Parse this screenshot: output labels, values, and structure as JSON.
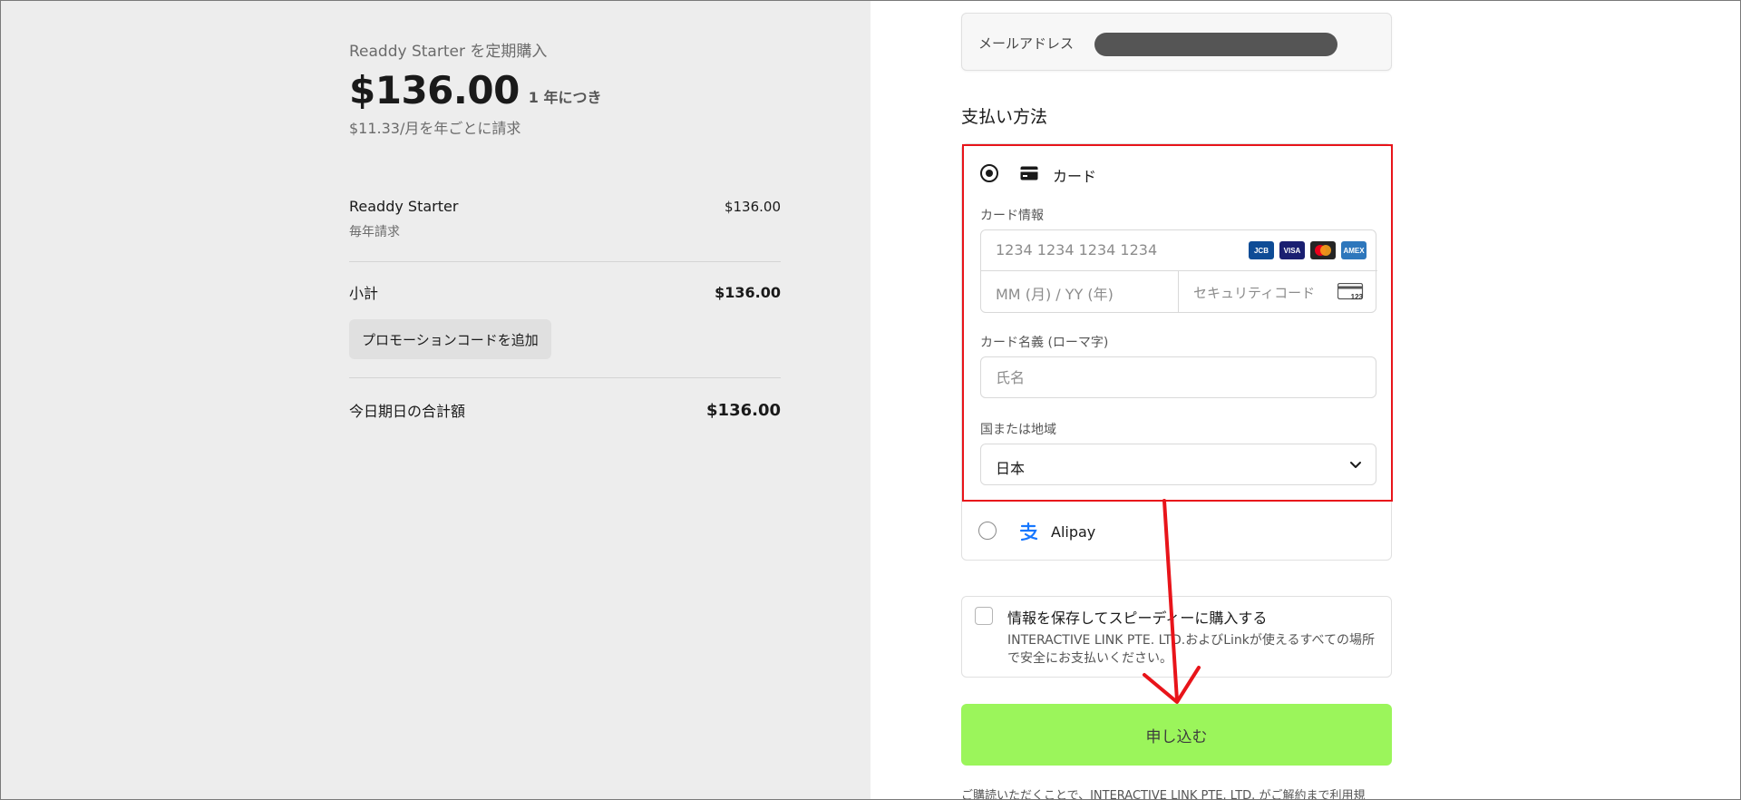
{
  "summary": {
    "plan_title": "Readdy Starter を定期購入",
    "price": "$136.00",
    "period": "1 年につき",
    "monthly": "$11.33/月を年ごとに請求",
    "line_item": {
      "name": "Readdy Starter",
      "price": "$136.00",
      "billing": "毎年請求"
    },
    "subtotal_label": "小計",
    "subtotal_value": "$136.00",
    "promo_button": "プロモーションコードを追加",
    "total_label": "今日期日の合計額",
    "total_value": "$136.00"
  },
  "form": {
    "email_label": "メールアドレス",
    "payment_heading": "支払い方法",
    "card_method_label": "カード",
    "card_info_label": "カード情報",
    "card_number_placeholder": "1234 1234 1234 1234",
    "brands": [
      "JCB",
      "VISA",
      "MC",
      "AMEX"
    ],
    "expiry_placeholder": "MM (月) / YY (年)",
    "cvc_placeholder": "セキュリティコード",
    "cvc_icon_text": "123",
    "name_label": "カード名義 (ローマ字)",
    "name_placeholder": "氏名",
    "country_label": "国または地域",
    "country_value": "日本",
    "alipay_label": "Alipay",
    "save_title": "情報を保存してスピーディーに購入する",
    "save_desc": "INTERACTIVE LINK PTE. LTD.およびLinkが使えるすべての場所で安全にお支払いください。",
    "submit_label": "申し込む",
    "terms": "ご購読いただくことで、INTERACTIVE LINK PTE. LTD. がご解約まで利用規"
  },
  "colors": {
    "annotation": "#e8141a",
    "submit": "#9bf55b",
    "left_bg": "#ededed"
  }
}
